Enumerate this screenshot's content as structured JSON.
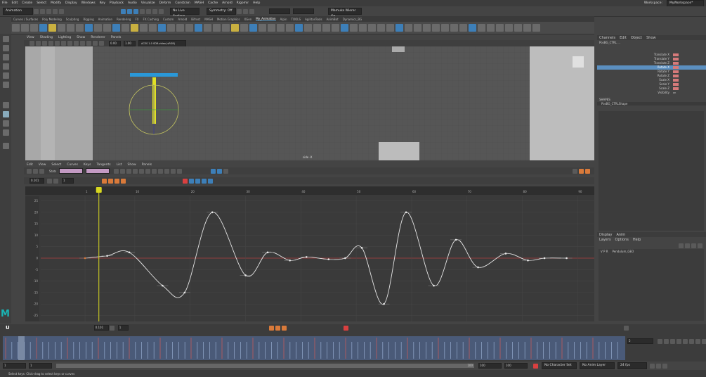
{
  "menubar": {
    "items": [
      "File",
      "Edit",
      "Create",
      "Select",
      "Modify",
      "Display",
      "Windows",
      "Key",
      "Playback",
      "Audio",
      "Visualize",
      "Deform",
      "Constrain",
      "MASH",
      "Cache",
      "Arnold",
      "Rigomir",
      "Help"
    ],
    "workspace_label": "Workspace:",
    "workspace_value": "MyWorkspace*"
  },
  "status": {
    "menuset": "Animation",
    "surface": "No Live Surface",
    "symmetry": "Symmetry: Off",
    "user": "Mamuka Wierer Ge..."
  },
  "shelf_tabs": {
    "items": [
      "Curves / Surfaces",
      "Poly Modeling",
      "Sculpting",
      "Rigging",
      "Animation",
      "Rendering",
      "FX",
      "FX Caching",
      "Custom",
      "Arnold",
      "Bifrost",
      "MASH",
      "Motion Graphics",
      "XGen",
      "My_Animation",
      "Alpin",
      "TOOLS",
      "AgilitasTools",
      "AnimBot",
      "Dynamics_BG"
    ],
    "active": "My_Animation"
  },
  "shelf_icons": [
    {
      "kind": "tool"
    },
    {
      "kind": "tool"
    },
    {
      "kind": "tool"
    },
    {
      "kind": "blue"
    },
    {
      "kind": "yellow"
    },
    {
      "kind": "tool"
    },
    {
      "kind": "tool"
    },
    {
      "kind": "tool"
    },
    {
      "kind": "blue"
    },
    {
      "kind": "tool"
    },
    {
      "kind": "tool"
    },
    {
      "kind": "blue"
    },
    {
      "kind": "tool"
    },
    {
      "kind": "yellow"
    },
    {
      "kind": "tool"
    },
    {
      "kind": "tool"
    },
    {
      "kind": "blue"
    },
    {
      "kind": "tool"
    },
    {
      "kind": "tool"
    },
    {
      "kind": "tool"
    },
    {
      "kind": "blue"
    },
    {
      "kind": "tool"
    },
    {
      "kind": "tool"
    },
    {
      "kind": "tool"
    },
    {
      "kind": "yellow"
    },
    {
      "kind": "tool"
    },
    {
      "kind": "blue"
    },
    {
      "kind": "tool"
    },
    {
      "kind": "tool"
    },
    {
      "kind": "tool"
    },
    {
      "kind": "tool"
    },
    {
      "kind": "blue"
    },
    {
      "kind": "tool"
    },
    {
      "kind": "tool"
    },
    {
      "kind": "tool"
    },
    {
      "kind": "tool"
    },
    {
      "kind": "blue"
    },
    {
      "kind": "tool"
    },
    {
      "kind": "tool"
    },
    {
      "kind": "tool"
    },
    {
      "kind": "tool"
    },
    {
      "kind": "tool"
    },
    {
      "kind": "blue"
    },
    {
      "kind": "tool"
    },
    {
      "kind": "tool"
    },
    {
      "kind": "tool"
    },
    {
      "kind": "tool"
    },
    {
      "kind": "tool"
    },
    {
      "kind": "tool"
    },
    {
      "kind": "tool"
    },
    {
      "kind": "blue"
    },
    {
      "kind": "tool"
    },
    {
      "kind": "tool"
    },
    {
      "kind": "tool"
    },
    {
      "kind": "tool"
    },
    {
      "kind": "tool"
    },
    {
      "kind": "tool"
    },
    {
      "kind": "tool"
    }
  ],
  "viewport": {
    "menu": [
      "View",
      "Shading",
      "Lighting",
      "Show",
      "Renderer",
      "Panels"
    ],
    "near": "0.00",
    "far": "1.00",
    "colorspace": "ACES 1.0 SDR-video (sRGB)",
    "camera_label": "side -X"
  },
  "graph_editor": {
    "menu": [
      "Edit",
      "View",
      "Select",
      "Curves",
      "Keys",
      "Tangents",
      "List",
      "Show",
      "Panels"
    ],
    "stats_label": "Stats",
    "frame_value": "0.101",
    "frame2": "1"
  },
  "channel_box": {
    "tabs": [
      "Channels",
      "Edit",
      "Object",
      "Show"
    ],
    "object": "PosBG_CTRL ...",
    "channels": [
      {
        "name": "Translate X",
        "value": "0",
        "sel": false
      },
      {
        "name": "Translate Y",
        "value": "0",
        "sel": false
      },
      {
        "name": "Translate Z",
        "value": "0",
        "sel": false
      },
      {
        "name": "Rotate X",
        "value": "0",
        "sel": true
      },
      {
        "name": "Rotate Y",
        "value": "0",
        "sel": false
      },
      {
        "name": "Rotate Z",
        "value": "0",
        "sel": false
      },
      {
        "name": "Scale X",
        "value": "1",
        "sel": false
      },
      {
        "name": "Scale Y",
        "value": "1",
        "sel": false
      },
      {
        "name": "Scale Z",
        "value": "1",
        "sel": false
      },
      {
        "name": "Visibility",
        "value": "on",
        "sel": false
      }
    ],
    "shapes_label": "SHAPES",
    "shape_name": "PosBG_CTRLShape"
  },
  "layers": {
    "tabs": [
      "Display",
      "Anim"
    ],
    "menu": [
      "Layers",
      "Options",
      "Help"
    ],
    "layer_flags": "V P R",
    "layer_name": "Pendulum_GEO"
  },
  "time": {
    "current_frame": "0.101",
    "current2": "1",
    "end_field": "5"
  },
  "range": {
    "start": "1",
    "start2": "1",
    "end": "100",
    "end2": "100",
    "end3": "100",
    "character_set": "No Character Set",
    "anim_layer": "No Anim Layer",
    "fps": "24 fps"
  },
  "help_text": "Select keys: Click-drag to select keys or curves",
  "chart_data": {
    "type": "line",
    "y_ticks": [
      "25",
      "20",
      "15",
      "10",
      "5",
      "0",
      "-5",
      "-10",
      "-15",
      "-20",
      "-25"
    ],
    "x_ticks": [
      "1",
      "10",
      "20",
      "30",
      "40",
      "50",
      "60",
      "70",
      "80",
      "90"
    ],
    "ylim": [
      -27,
      27
    ],
    "xlim": [
      -7,
      93
    ],
    "points": [
      [
        1,
        0
      ],
      [
        5,
        1
      ],
      [
        9,
        2.5
      ],
      [
        15,
        -12
      ],
      [
        19,
        -15
      ],
      [
        24,
        20
      ],
      [
        30,
        -7.5
      ],
      [
        34,
        2.5
      ],
      [
        38,
        -1
      ],
      [
        41,
        0.5
      ],
      [
        45,
        -0.5
      ],
      [
        48,
        0
      ],
      [
        51,
        4.5
      ],
      [
        55,
        -20
      ],
      [
        59,
        20
      ],
      [
        64,
        -12
      ],
      [
        68,
        8
      ],
      [
        72,
        -4
      ],
      [
        77,
        2
      ],
      [
        81,
        -1
      ],
      [
        84,
        0
      ],
      [
        88,
        0
      ]
    ],
    "current_frame_x": 3.5
  }
}
